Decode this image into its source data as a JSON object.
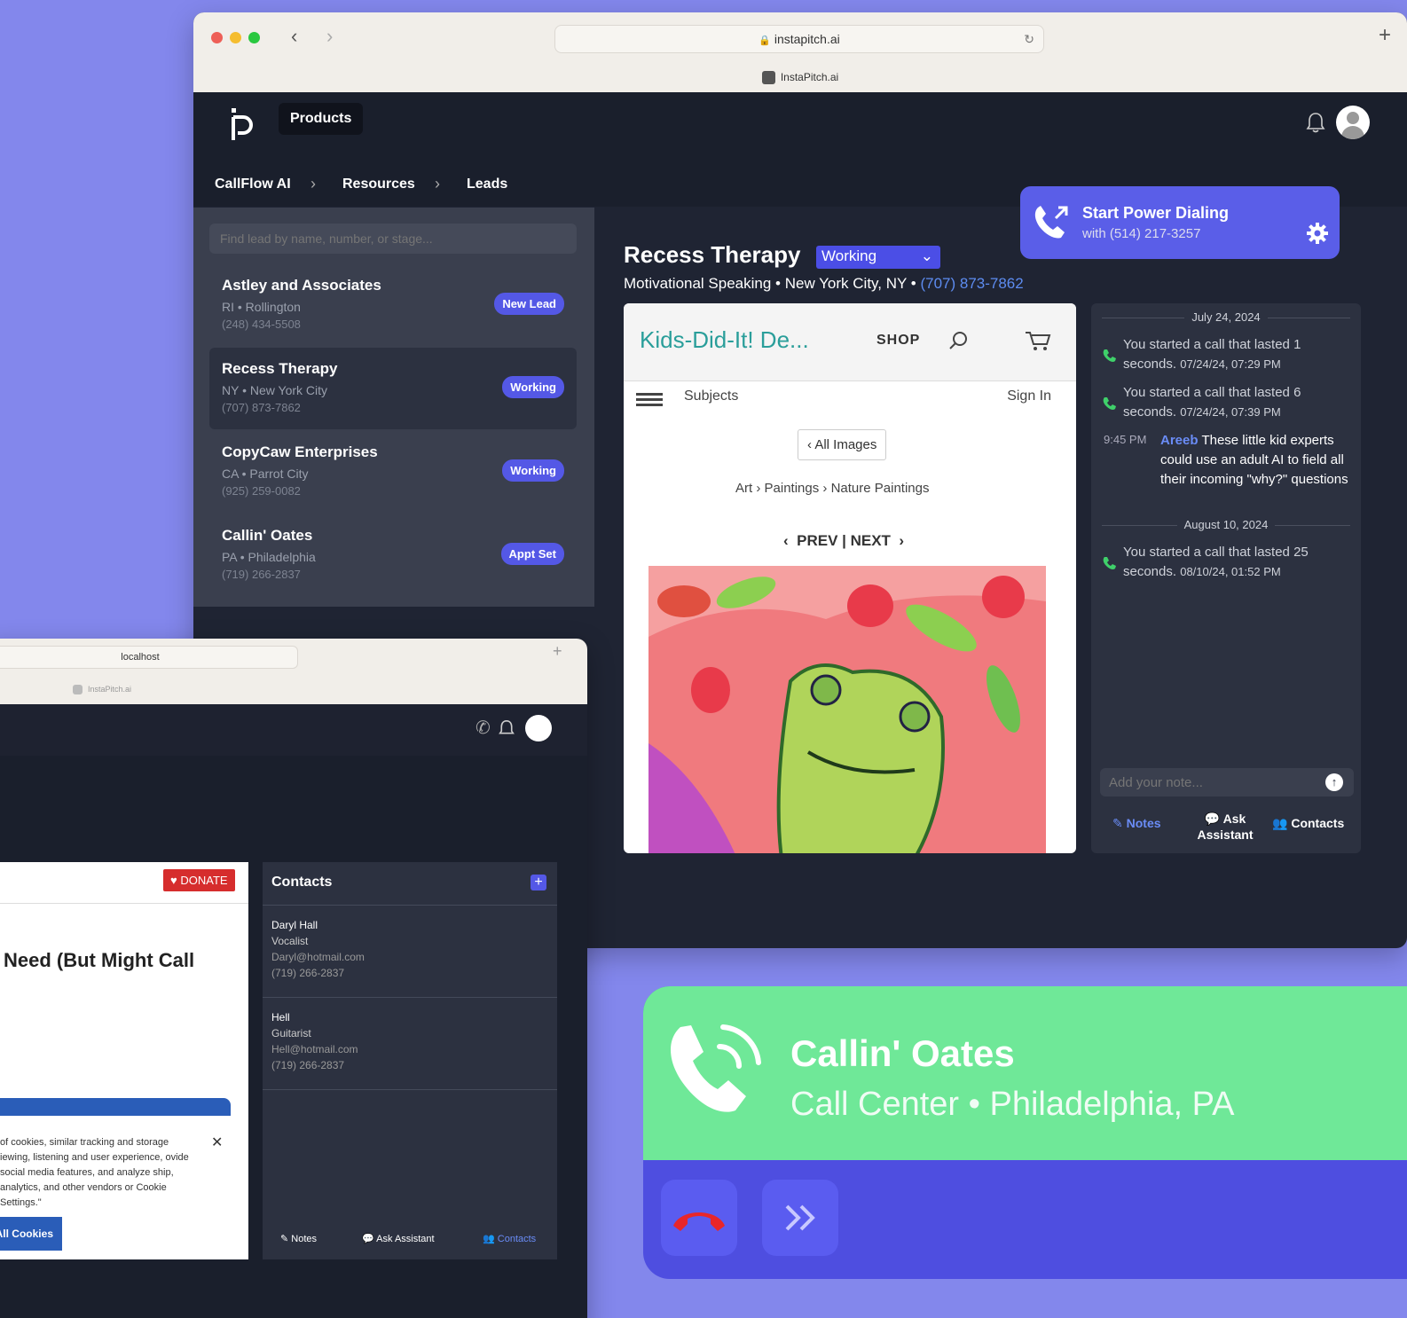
{
  "browser_main": {
    "url": "instapitch.ai",
    "tab_title": "InstaPitch.ai",
    "nav_products": "Products",
    "breadcrumb": [
      "CallFlow AI",
      "Resources",
      "Leads"
    ],
    "search_placeholder": "Find lead by name, number, or stage...",
    "leads": [
      {
        "name": "Astley and Associates",
        "location": "RI • Rollington",
        "phone": "(248) 434-5508",
        "stage": "New Lead"
      },
      {
        "name": "Recess Therapy",
        "location": "NY • New York City",
        "phone": "(707) 873-7862",
        "stage": "Working"
      },
      {
        "name": "CopyCaw Enterprises",
        "location": "CA • Parrot City",
        "phone": "(925) 259-0082",
        "stage": "Working"
      },
      {
        "name": "Callin' Oates",
        "location": "PA • Philadelphia",
        "phone": "(719) 266-2837",
        "stage": "Appt Set"
      }
    ],
    "power_dial": {
      "title": "Start Power Dialing",
      "subtitle": "with (514) 217-3257"
    },
    "detail": {
      "title": "Recess Therapy",
      "status": "Working",
      "subtitle": "Motivational Speaking • New York City, NY •",
      "phone": "(707) 873-7862"
    },
    "site": {
      "brand": "Kids-Did-It! De...",
      "shop": "SHOP",
      "subjects": "Subjects",
      "sign_in": "Sign In",
      "all_images": "All Images",
      "crumbs": [
        "Art",
        "Paintings",
        "Nature Paintings"
      ],
      "prev_next": "PREV | NEXT"
    },
    "timeline": {
      "date1": "July 24, 2024",
      "call1_text": "You started a call that lasted 1 seconds.",
      "call1_time": "07/24/24, 07:29 PM",
      "call2_text": "You started a call that lasted 6 seconds.",
      "call2_time": "07/24/24, 07:39 PM",
      "note_time": "9:45 PM",
      "note_author": "Areeb",
      "note_text": "These little kid experts could use an adult AI to field all their incoming \"why?\" questions",
      "date2": "August 10, 2024",
      "call3_text": "You started a call that lasted 25 seconds.",
      "call3_time": "08/10/24, 01:52 PM",
      "note_placeholder": "Add your note...",
      "tab_notes": "Notes",
      "tab_ask": "Ask Assistant",
      "tab_contacts": "Contacts"
    }
  },
  "browser_second": {
    "url": "localhost",
    "tab_title": "InstaPitch.ai",
    "donate": "DONATE",
    "heading_fragment": "Need (But Might Call",
    "cookie_text": "of cookies, similar tracking and storage iewing, listening and user experience, ovide social media features, and analyze ship, analytics, and other vendors or Cookie Settings.\"",
    "cookie_button": "All Cookies",
    "contacts_title": "Contacts",
    "contacts": [
      {
        "name": "Daryl Hall",
        "role": "Vocalist",
        "email": "Daryl@hotmail.com",
        "phone": "(719) 266-2837"
      },
      {
        "name": "Hell",
        "role": "Guitarist",
        "email": "Hell@hotmail.com",
        "phone": "(719) 266-2837"
      }
    ],
    "tab_notes": "Notes",
    "tab_ask": "Ask Assistant",
    "tab_contacts": "Contacts"
  },
  "call_card": {
    "name": "Callin' Oates",
    "subtitle": "Call Center • Philadelphia, PA"
  },
  "colors": {
    "accent": "#5458e6",
    "call_green": "#6fe898",
    "background": "#8387ec"
  }
}
